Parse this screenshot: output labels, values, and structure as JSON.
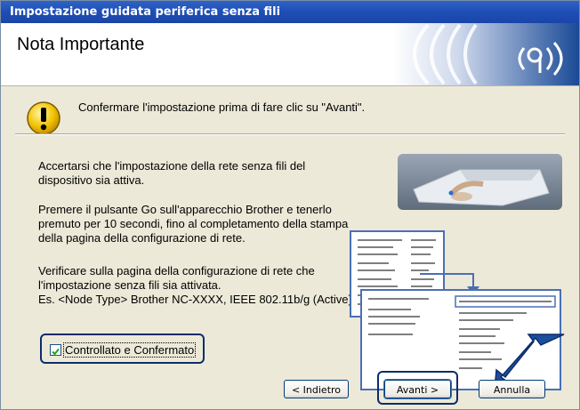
{
  "window": {
    "title": "Impostazione guidata periferica senza fili"
  },
  "header": {
    "title": "Nota Importante",
    "logo_icon": "wireless-logo-icon"
  },
  "notice": {
    "icon": "warning-icon",
    "text": "Confermare l'impostazione prima di fare clic su \"Avanti\"."
  },
  "body": {
    "paragraph1": "Accertarsi che l'impostazione della rete senza fili del\ndispositivo sia attiva.",
    "paragraph2": "Premere il pulsante Go sull'apparecchio Brother e tenerlo\npremuto per 10 secondi, fino al completamento  della stampa\ndella pagina della configurazione di rete.",
    "paragraph3": "Verificare sulla pagina della configurazione di rete che\nl'impostazione senza fili sia attivata.\nEs. <Node Type> Brother NC-XXXX, IEEE 802.11b/g (Active)"
  },
  "checkbox": {
    "label": "Controllato e Confermato",
    "checked": true
  },
  "buttons": {
    "back": "< Indietro",
    "next": "Avanti >",
    "cancel": "Annulla"
  },
  "colors": {
    "titlebar": "#1f4fb7",
    "dialog_bg": "#ece9d8",
    "highlight_ring": "#0d2c6c",
    "arrow": "#1c4f9c"
  }
}
